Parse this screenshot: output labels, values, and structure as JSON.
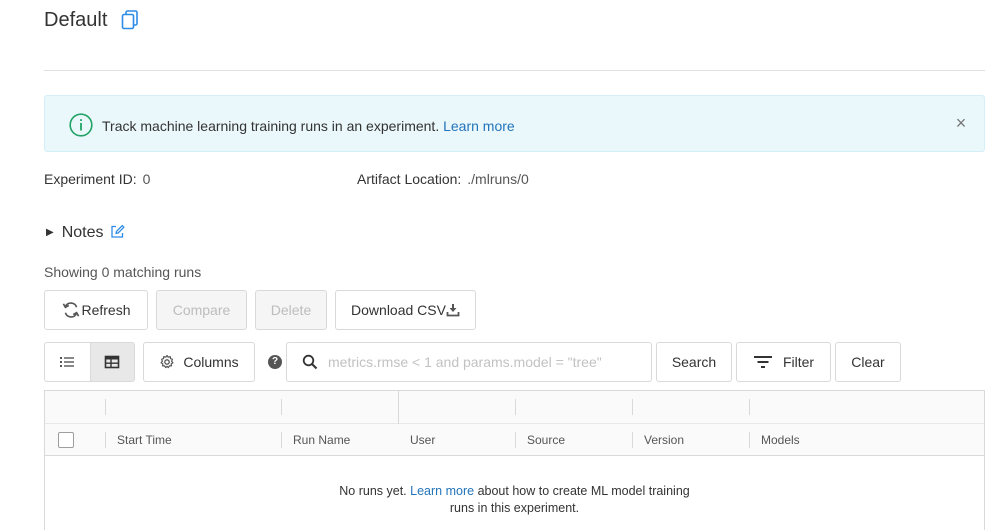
{
  "experiment": {
    "title": "Default"
  },
  "banner": {
    "message": "Track machine learning training runs in an experiment.",
    "link": "Learn more",
    "close": "×"
  },
  "meta": {
    "experiment_id_label": "Experiment ID:",
    "experiment_id_value": "0",
    "artifact_location_label": "Artifact Location:",
    "artifact_location_value": "./mlruns/0"
  },
  "notes": {
    "label": "Notes"
  },
  "runs": {
    "showing_text": "Showing 0 matching runs"
  },
  "toolbar": {
    "refresh_label": "Refresh",
    "compare_label": "Compare",
    "delete_label": "Delete",
    "download_label": "Download CSV",
    "columns_label": "Columns",
    "help": "?",
    "search_placeholder": "metrics.rmse < 1 and params.model = \"tree\"",
    "search_value": "",
    "search_button": "Search",
    "filter_button": "Filter",
    "clear_button": "Clear"
  },
  "table": {
    "columns": [
      "Start Time",
      "Run Name",
      "User",
      "Source",
      "Version",
      "Models"
    ],
    "empty_prefix": "No runs yet.",
    "empty_link": "Learn more",
    "empty_suffix": "about how to create ML model training",
    "empty_line2": "runs in this experiment."
  },
  "colors": {
    "accent": "#2374bb",
    "banner_bg": "#eaf7fb",
    "success_icon": "#21a366"
  }
}
